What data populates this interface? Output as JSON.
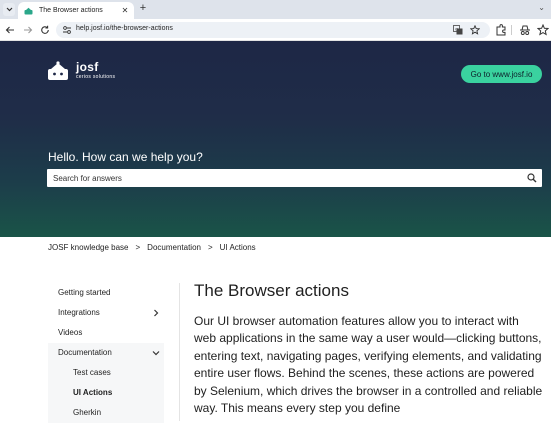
{
  "browser": {
    "tab_title": "The Browser actions",
    "url": "help.josf.io/the-browser-actions"
  },
  "hero": {
    "logo_name": "josf",
    "logo_sub": "cerios solutions",
    "cta_label": "Go to www.josf.io",
    "heading": "Hello. How can we help you?",
    "search_placeholder": "Search for answers"
  },
  "breadcrumb": {
    "items": [
      "JOSF knowledge base",
      "Documentation",
      "UI Actions"
    ],
    "separator": ">"
  },
  "sidebar": {
    "items": [
      {
        "label": "Getting started"
      },
      {
        "label": "Integrations"
      },
      {
        "label": "Videos"
      },
      {
        "label": "Documentation"
      },
      {
        "label": "Test cases"
      },
      {
        "label": "UI Actions"
      },
      {
        "label": "Gherkin"
      }
    ]
  },
  "article": {
    "title": "The Browser actions",
    "body": "Our UI browser automation features allow you to interact with web applications in the same way a user would—clicking buttons, entering text, navigating pages, verifying elements, and validating entire user flows. Behind the scenes, these actions are powered by Selenium, which drives the browser in a controlled and reliable way. This means every step you define"
  },
  "colors": {
    "hero_top": "#1e2746",
    "hero_bottom": "#1a5448",
    "cta": "#3ad29f"
  }
}
